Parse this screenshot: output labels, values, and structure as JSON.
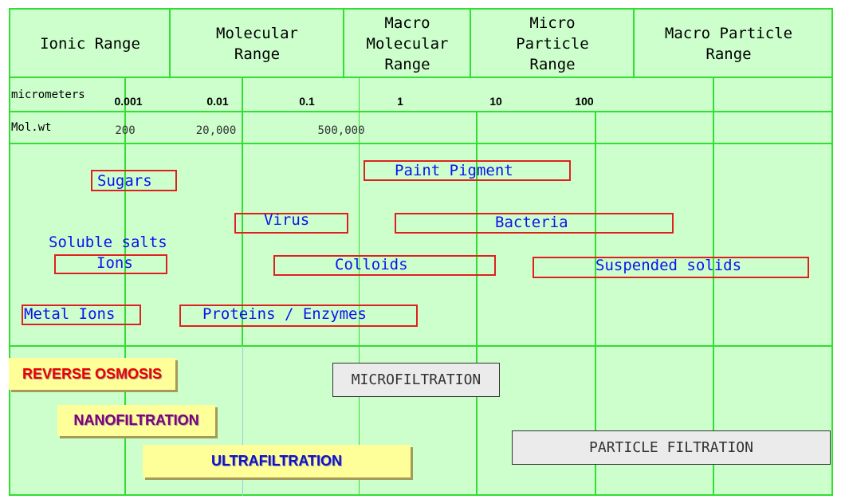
{
  "header": [
    "Ionic Range",
    "Molecular\nRange",
    "Macro\nMolecular\nRange",
    "Micro\nParticle\nRange",
    "Macro Particle\nRange"
  ],
  "scale": {
    "micrometers_label": "micrometers",
    "micrometers": [
      "0.001",
      "0.01",
      "0.1",
      "1",
      "10",
      "100"
    ],
    "molwt_label": "Mol.wt",
    "molwt": [
      "200",
      "20,000",
      "500,000"
    ]
  },
  "particles": {
    "sugars": "Sugars",
    "paint": "Paint Pigment",
    "virus": "Virus",
    "bacteria": "Bacteria",
    "soluble_salts": "Soluble salts",
    "ions": "Ions",
    "colloids": "Colloids",
    "suspended": "Suspended solids",
    "metal_ions": "Metal Ions",
    "proteins": "Proteins / Enzymes"
  },
  "processes": {
    "ro": "REVERSE OSMOSIS",
    "nf": "NANOFILTRATION",
    "uf": "ULTRAFILTRATION",
    "mf": "MICROFILTRATION",
    "pf": "PARTICLE FILTRATION"
  },
  "colors": {
    "background": "#ccffcc",
    "grid": "#33dd33",
    "particle_text": "#1010ee",
    "particle_box": "#e02020",
    "ro": "#ee0000",
    "nf": "#800080",
    "uf": "#1010cc"
  }
}
